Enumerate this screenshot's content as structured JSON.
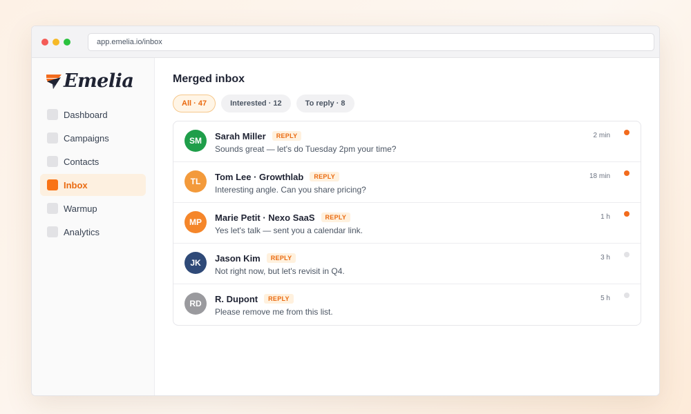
{
  "browser": {
    "url": "app.emelia.io/inbox",
    "dots": [
      "#f45b57",
      "#f6b927",
      "#2bc23f"
    ]
  },
  "logo": {
    "word": "Emelia",
    "accent": "#f26b1d"
  },
  "sidebar": {
    "items": [
      {
        "label": "Dashboard",
        "active": false
      },
      {
        "label": "Campaigns",
        "active": false
      },
      {
        "label": "Contacts",
        "active": false
      },
      {
        "label": "Inbox",
        "active": true
      },
      {
        "label": "Warmup",
        "active": false
      },
      {
        "label": "Analytics",
        "active": false
      }
    ]
  },
  "main": {
    "title": "Merged inbox",
    "filters": [
      {
        "label": "All · 47",
        "active": true
      },
      {
        "label": "Interested · 12",
        "active": false
      },
      {
        "label": "To reply · 8",
        "active": false
      }
    ],
    "messages": [
      {
        "initials": "SM",
        "sender": "Sarah Miller",
        "tag": "REPLY",
        "preview": "Sounds great — let's do Tuesday 2pm your time?",
        "time": "2 min",
        "avatar_color": "#1f9e4a",
        "unread": true
      },
      {
        "initials": "TL",
        "sender": "Tom Lee · Growthlab",
        "tag": "REPLY",
        "preview": "Interesting angle. Can you share pricing?",
        "time": "18 min",
        "avatar_color": "#f39a3b",
        "unread": true
      },
      {
        "initials": "MP",
        "sender": "Marie Petit · Nexo SaaS",
        "tag": "REPLY",
        "preview": "Yes let's talk — sent you a calendar link.",
        "time": "1 h",
        "avatar_color": "#f5862a",
        "unread": true
      },
      {
        "initials": "JK",
        "sender": "Jason Kim",
        "tag": "REPLY",
        "preview": "Not right now, but let's revisit in Q4.",
        "time": "3 h",
        "avatar_color": "#2f4a78",
        "unread": false
      },
      {
        "initials": "RD",
        "sender": "R. Dupont",
        "tag": "REPLY",
        "preview": "Please remove me from this list.",
        "time": "5 h",
        "avatar_color": "#9a9a9e",
        "unread": false
      }
    ]
  },
  "colors": {
    "accent": "#f97316",
    "unread_dot": "#f26b1d",
    "read_dot": "#e2e2e5"
  }
}
